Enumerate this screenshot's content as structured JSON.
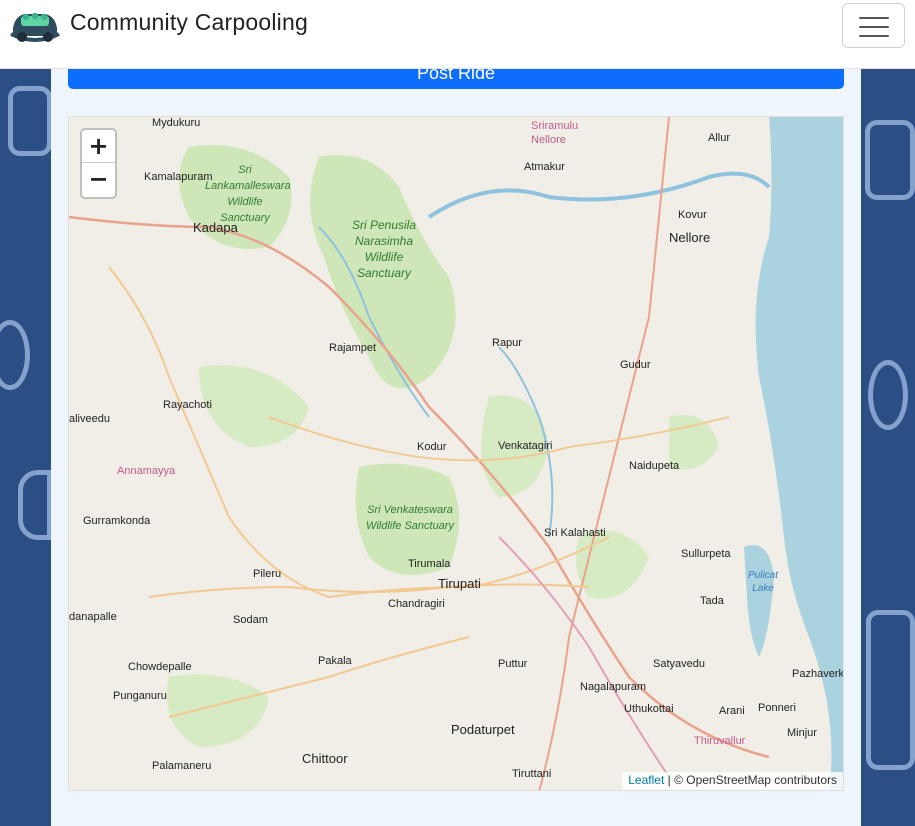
{
  "navbar": {
    "brand": "Community Carpooling",
    "logo_icon": "carpool-car-icon",
    "menu_icon": "hamburger-menu-icon"
  },
  "actions": {
    "post_ride_label": "Post Ride"
  },
  "map": {
    "zoom_in_label": "+",
    "zoom_out_label": "−",
    "attribution_leaflet": "Leaflet",
    "attribution_rest": "| © OpenStreetMap contributors",
    "cities": [
      "Mydukuru",
      "Kamalapuram",
      "Kadapa",
      "Rajampet",
      "Rayachoti",
      "aliveedu",
      "Gurramkonda",
      "Pileru",
      "Sodam",
      "danapalle",
      "Chowdepalle",
      "Punganuru",
      "Palamaneru",
      "Chittoor",
      "Pakala",
      "Chandragiri",
      "Tirupati",
      "Tirumala",
      "Puttur",
      "Podaturpet",
      "Tiruttani",
      "Nagalapuram",
      "Uthukottai",
      "Arani",
      "Ponneri",
      "Minjur",
      "Pazhaverk",
      "Satyavedu",
      "Tada",
      "Sullurpeta",
      "Sri Kalahasti",
      "Naidupeta",
      "Venkatagiri",
      "Kodur",
      "Rapur",
      "Gudur",
      "Nellore",
      "Kovur",
      "Allur",
      "Atmakur"
    ],
    "parks": [
      "Sri Lankamalleswara Wildlife Sanctuary",
      "Sri Penusila Narasimha Wildlife Sanctuary",
      "Sri Venkateswara Wildlife Sanctuary"
    ],
    "regions": [
      "Annamayya",
      "Sriramulu Nellore",
      "Thiruvallur"
    ],
    "lakes": [
      "Pulicat Lake"
    ]
  }
}
